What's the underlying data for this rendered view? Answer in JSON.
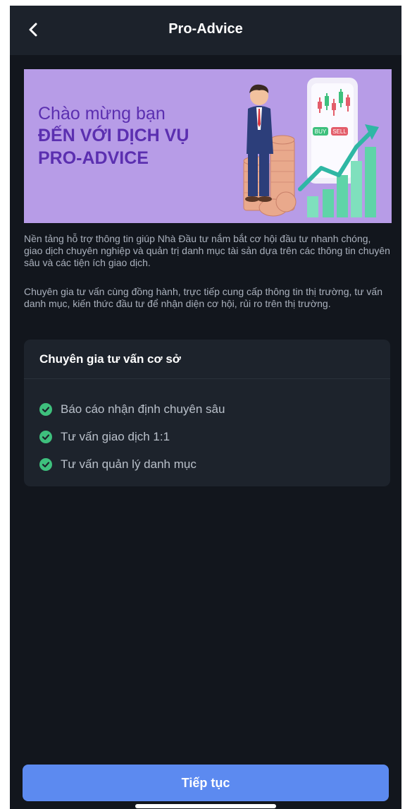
{
  "header": {
    "title": "Pro-Advice",
    "back_icon": "chevron-left-icon"
  },
  "banner": {
    "line1": "Chào mừng bạn",
    "line2": "ĐẾN VỚI DỊCH VỤ",
    "line3": "PRO-ADVICE",
    "tag_buy": "BUY",
    "tag_sell": "SELL"
  },
  "description": {
    "para1": "Nền tảng hỗ trợ thông tin giúp Nhà Đầu tư nắm bắt cơ hội đầu tư nhanh chóng, giao dịch chuyên nghiệp và quản trị danh mục tài sản dựa trên các thông tin chuyên sâu và các tiện ích giao dịch.",
    "para2": "Chuyên gia tư vấn cùng đồng hành, trực tiếp cung cấp thông tin thị trường, tư vấn danh mục, kiến thức đầu tư để nhận diện cơ hội, rủi ro trên thị trường."
  },
  "plan_card": {
    "title": "Chuyên gia tư vấn cơ sở",
    "features": [
      "Báo cáo nhận định chuyên sâu",
      "Tư vấn giao dịch 1:1",
      "Tư vấn quản lý danh mục"
    ]
  },
  "continue_button": {
    "label": "Tiếp tục"
  },
  "colors": {
    "background": "#12161d",
    "card": "#1d232c",
    "accent": "#5c8af0",
    "check": "#3ec07d",
    "banner": "#b79ce7"
  }
}
